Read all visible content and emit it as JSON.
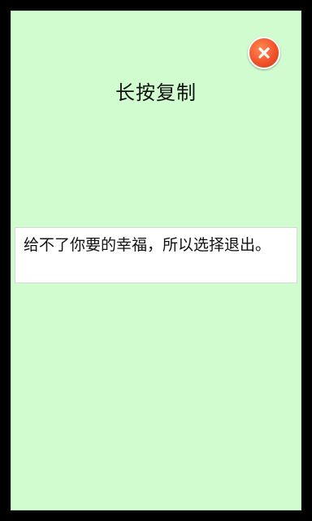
{
  "dialog": {
    "title": "长按复制",
    "content": "给不了你要的幸福，所以选择退出。",
    "close_icon": "close-icon"
  },
  "colors": {
    "background": "#d0fcd0",
    "close_button": "#f2542a",
    "text_box": "#ffffff"
  }
}
